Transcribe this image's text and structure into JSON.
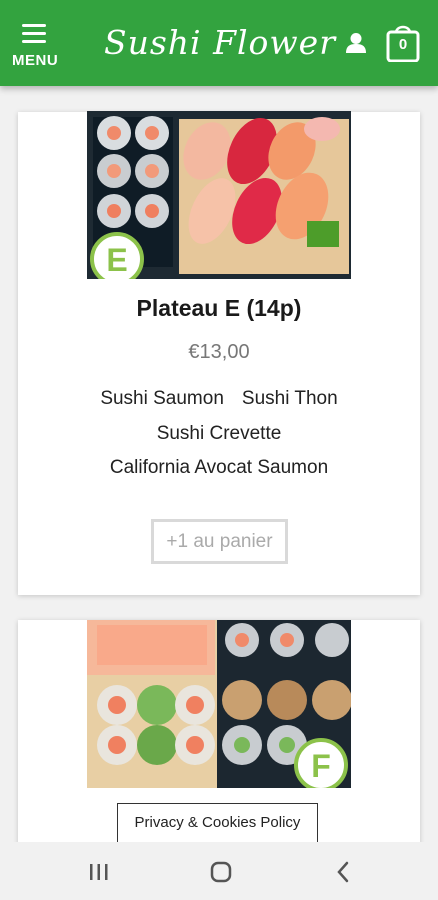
{
  "header": {
    "menu_label": "MENU",
    "logo_text": "Sushi Flower",
    "cart_count": "0",
    "brand_color": "#33a33f"
  },
  "products": [
    {
      "title": "Plateau E (14p)",
      "price": "€13,00",
      "ingredients_line1": [
        "Sushi Saumon",
        "Sushi Thon"
      ],
      "ingredients_line2": "Sushi Crevette",
      "ingredients_line3": "California Avocat Saumon",
      "add_button_label": "+1 au panier",
      "photo_badge": "E"
    },
    {
      "photo_badge": "F"
    }
  ],
  "privacy_label": "Privacy & Cookies Policy",
  "icons": [
    "hamburger-icon",
    "user-icon",
    "cart-icon",
    "recent-apps-icon",
    "home-icon",
    "back-icon"
  ]
}
